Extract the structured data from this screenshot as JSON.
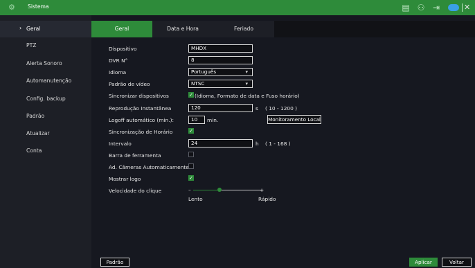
{
  "header": {
    "title": "Sistema",
    "icons": [
      "system-logo-icon",
      "storage-icon",
      "user-account-icon",
      "logout-icon",
      "cloud-icon",
      "close-icon"
    ]
  },
  "sidebar": {
    "items": [
      {
        "label": "Geral"
      },
      {
        "label": "PTZ"
      },
      {
        "label": "Alerta Sonoro"
      },
      {
        "label": "Automanutenção"
      },
      {
        "label": "Config. backup"
      },
      {
        "label": "Padrão"
      },
      {
        "label": "Atualizar"
      },
      {
        "label": "Conta"
      }
    ]
  },
  "tabs": [
    {
      "label": "Geral"
    },
    {
      "label": "Data e Hora"
    },
    {
      "label": "Feriado"
    }
  ],
  "form": {
    "device_label": "Dispositivo",
    "device_value": "MHDX",
    "dvr_label": "DVR N°",
    "dvr_value": "8",
    "language_label": "Idioma",
    "language_value": "Português",
    "video_label": "Padrão de vídeo",
    "video_value": "NTSC",
    "sync_devices_label": "Sincronizar dispositivos",
    "sync_devices_text": "(Idioma, Formato de data e Fuso horário)",
    "instant_label": "Reprodução Instantânea",
    "instant_value": "120",
    "instant_unit": "s",
    "instant_range": "( 10 - 1200 )",
    "logoff_label": "Logoff automático (min.):",
    "logoff_value": "10",
    "logoff_unit": "min.",
    "local_monitor_button": "Monitoramento Local",
    "time_sync_label": "Sincronização de Horário",
    "interval_label": "Intervalo",
    "interval_value": "24",
    "interval_unit": "h",
    "interval_range": "( 1 - 168 )",
    "toolbar_label": "Barra de ferramenta",
    "auto_cameras_label": "Ad. Câmeras Automaticamente",
    "show_logo_label": "Mostrar logo",
    "click_speed_label": "Velocidade do clique",
    "slow_label": "Lento",
    "fast_label": "Rápido",
    "minus_sign": "–",
    "plus_sign": "+",
    "click_speed_level": 0.38
  },
  "footer": {
    "default_button": "Padrão",
    "apply_button": "Aplicar",
    "back_button": "Voltar"
  },
  "colors": {
    "accent": "#2e8b3a",
    "background": "#161820",
    "sidebar": "#1d1f26"
  }
}
